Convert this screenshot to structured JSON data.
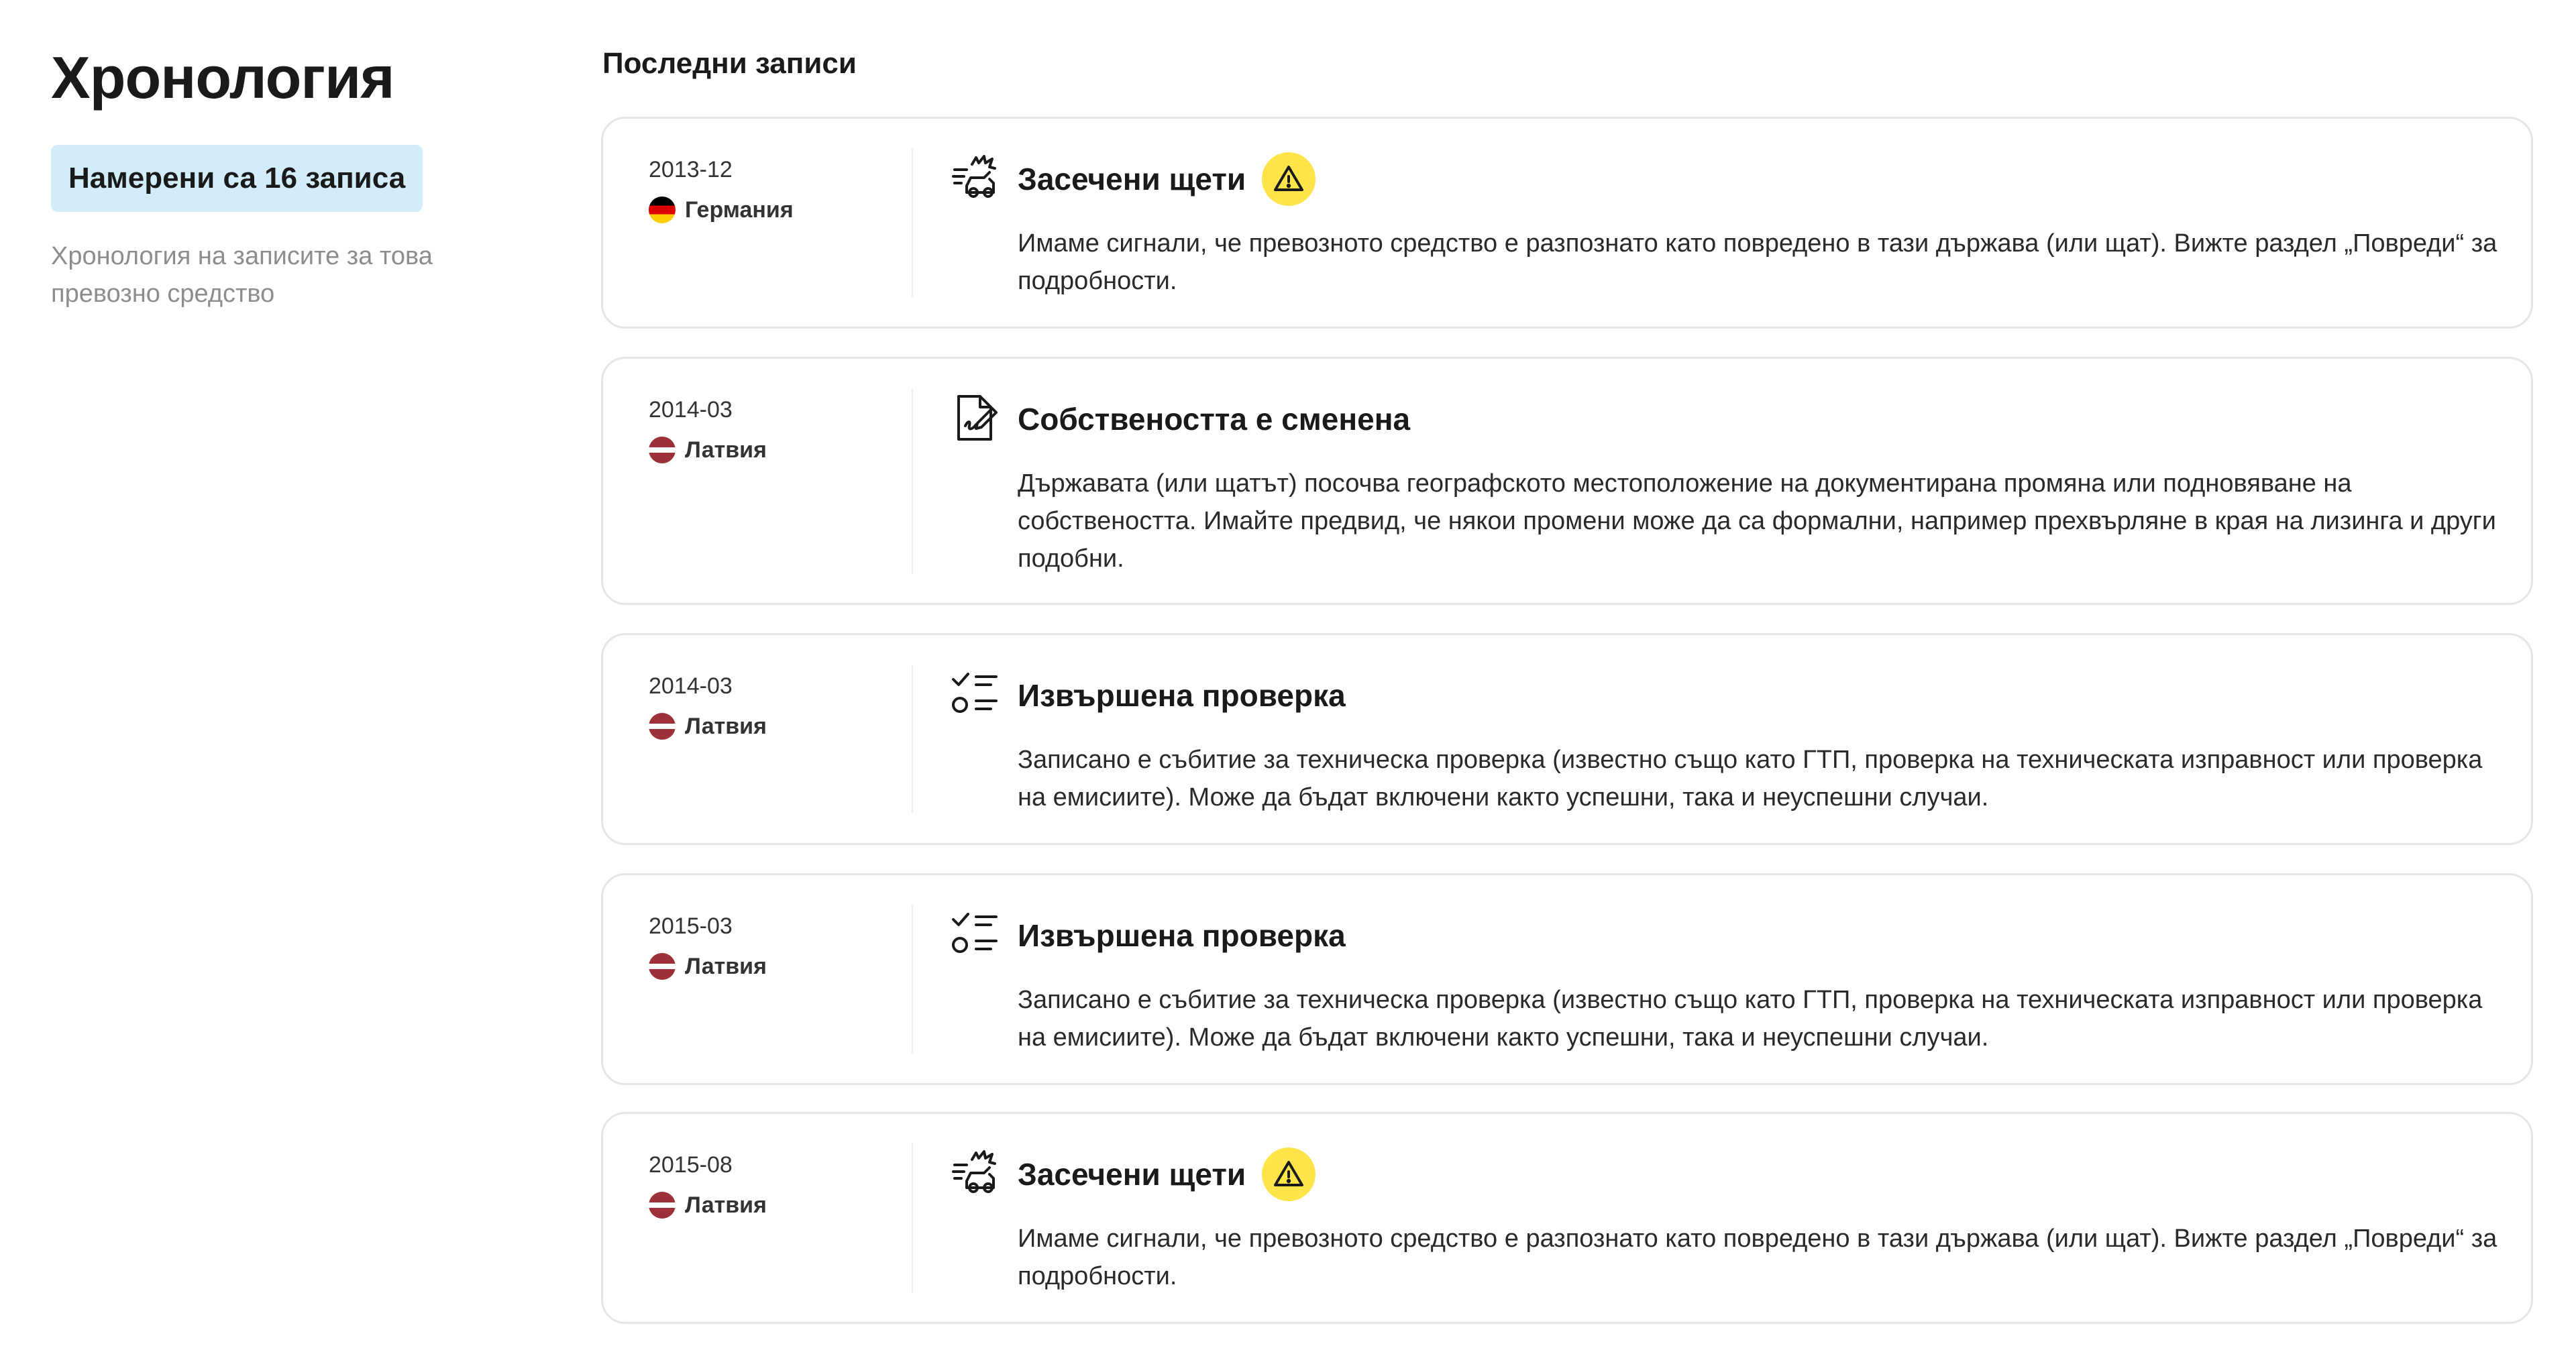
{
  "sidebar": {
    "title": "Хронология",
    "count_badge": "Намерени са 16 записа",
    "description": "Хронология на записите за това превозно средство"
  },
  "main": {
    "section_title": "Последни записи",
    "entries": [
      {
        "date": "2013-12",
        "country": "Германия",
        "flag": "germany",
        "icon": "car-damage-icon",
        "title": "Засечени щети",
        "warning": true,
        "description": "Имаме сигнали, че превозното средство е разпознато като повредено в тази държава (или щат). Вижте раздел „Повреди“ за подробности."
      },
      {
        "date": "2014-03",
        "country": "Латвия",
        "flag": "latvia",
        "icon": "document-signature-icon",
        "title": "Собствеността е сменена",
        "warning": false,
        "description": "Държавата (или щатът) посочва географското местоположение на документирана промяна или подновяване на собствеността. Имайте предвид, че някои промени може да са формални, например прехвърляне в края на лизинга и други подобни."
      },
      {
        "date": "2014-03",
        "country": "Латвия",
        "flag": "latvia",
        "icon": "checklist-icon",
        "title": "Извършена проверка",
        "warning": false,
        "description": "Записано е събитие за техническа проверка (известно също като ГТП, проверка на техническата изправност или проверка на емисиите). Може да бъдат включени както успешни, така и неуспешни случаи."
      },
      {
        "date": "2015-03",
        "country": "Латвия",
        "flag": "latvia",
        "icon": "checklist-icon",
        "title": "Извършена проверка",
        "warning": false,
        "description": "Записано е събитие за техническа проверка (известно също като ГТП, проверка на техническата изправност или проверка на емисиите). Може да бъдат включени както успешни, така и неуспешни случаи."
      },
      {
        "date": "2015-08",
        "country": "Латвия",
        "flag": "latvia",
        "icon": "car-damage-icon",
        "title": "Засечени щети",
        "warning": true,
        "description": "Имаме сигнали, че превозното средство е разпознато като повредено в тази държава (или щат). Вижте раздел „Повреди“ за подробности."
      }
    ]
  },
  "colors": {
    "badge_bg": "#d3ecfa",
    "warning": "#ffe54a",
    "card_border": "#e6e6e6",
    "muted_text": "#8d8d8d"
  }
}
